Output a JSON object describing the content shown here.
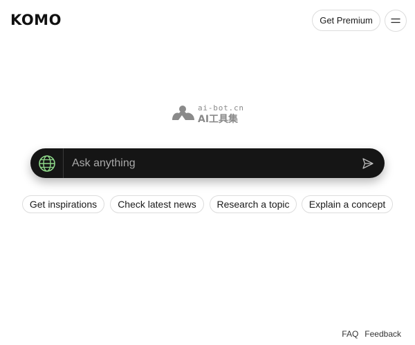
{
  "header": {
    "logo": "KOMO",
    "premium_label": "Get Premium",
    "menu_icon": "menu-icon"
  },
  "watermark": {
    "top_text": "ai-bot.cn",
    "bottom_text": "AI工具集",
    "icon": "cloud-logo-icon"
  },
  "search": {
    "placeholder": "Ask anything",
    "value": "",
    "globe_icon": "globe-icon",
    "send_icon": "send-icon"
  },
  "suggestions": [
    {
      "label": "Get inspirations"
    },
    {
      "label": "Check latest news"
    },
    {
      "label": "Research a topic"
    },
    {
      "label": "Explain a concept"
    }
  ],
  "footer": {
    "links": [
      {
        "label": "FAQ"
      },
      {
        "label": "Feedback"
      }
    ]
  },
  "colors": {
    "search_bg": "#151515",
    "globe_accent": "#8fd98a",
    "chip_border": "#dcdcdc",
    "watermark": "#8a8a8a"
  }
}
